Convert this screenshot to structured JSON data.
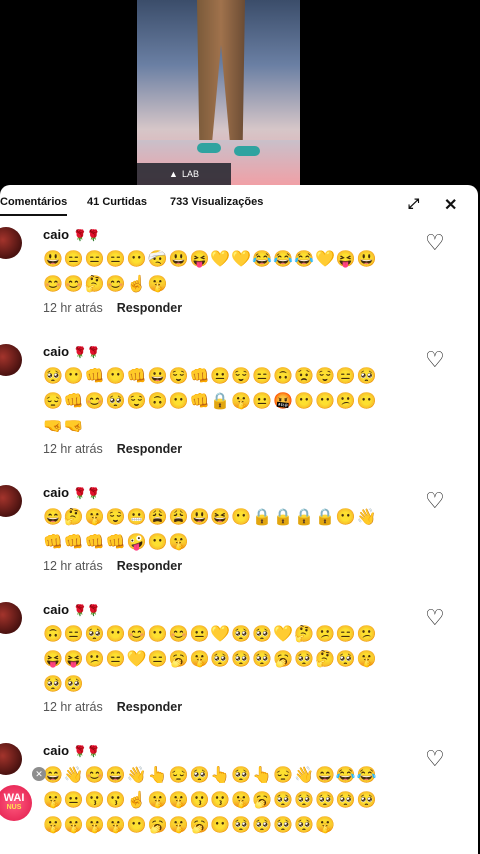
{
  "video": {
    "label": "LAB"
  },
  "tabs": {
    "comments": "Comentários",
    "likes_count": "41",
    "likes_label": "Curtidas",
    "views_count": "733",
    "views_label": "Visualizações"
  },
  "controls": {
    "expand_icon": "expand-icon",
    "close_icon": "close-icon"
  },
  "comments": [
    {
      "user": "caio",
      "roses": "🌹🌹",
      "text": "😃😑😑😑😶🤕😃😝💛💛😂😂😂💛😝😃😊😊🤔😊☝️🤫",
      "time": "12 hr atrás",
      "reply": "Responder"
    },
    {
      "user": "caio",
      "roses": "🌹🌹",
      "text": "🥺😶👊😶👊😀😌👊😐😌😑🙃😟😌😑🥺😔👊😊🥺😌🙃😶👊🔒🤫😐🤬😶😶😕😶🤜🤜",
      "time": "12 hr atrás",
      "reply": "Responder"
    },
    {
      "user": "caio",
      "roses": "🌹🌹",
      "text": "😄🤔🤫😌😬😩😩😃😆😶🔒🔒🔒🔒😶👋👊👊👊👊🤪😶🤫",
      "time": "12 hr atrás",
      "reply": "Responder"
    },
    {
      "user": "caio",
      "roses": "🌹🌹",
      "text": "🙃😑🥺😶😊😶😊😐💛🥺🥺💛🤔😕😑😕😝😝😕😑💛😑🥱🤫🥺🥺🥺🥱🥺🤔🥺🤫🥺🥺",
      "time": "12 hr atrás",
      "reply": "Responder"
    },
    {
      "user": "caio",
      "roses": "🌹🌹",
      "text": "😄👋😊😄👋👆😔🥺👆🥺👆😔👋😄😂😂🤫😐😗😗☝️🤫🤫😗😗🤫🥱🥺🥺🥺🥺🥺🤫🤫🤫🤫😶🥱🤫🥱😶🥺🥺🥺🥺🤫",
      "time": "",
      "reply": ""
    }
  ],
  "badge": {
    "line1": "WAI",
    "line2": "NUS"
  }
}
